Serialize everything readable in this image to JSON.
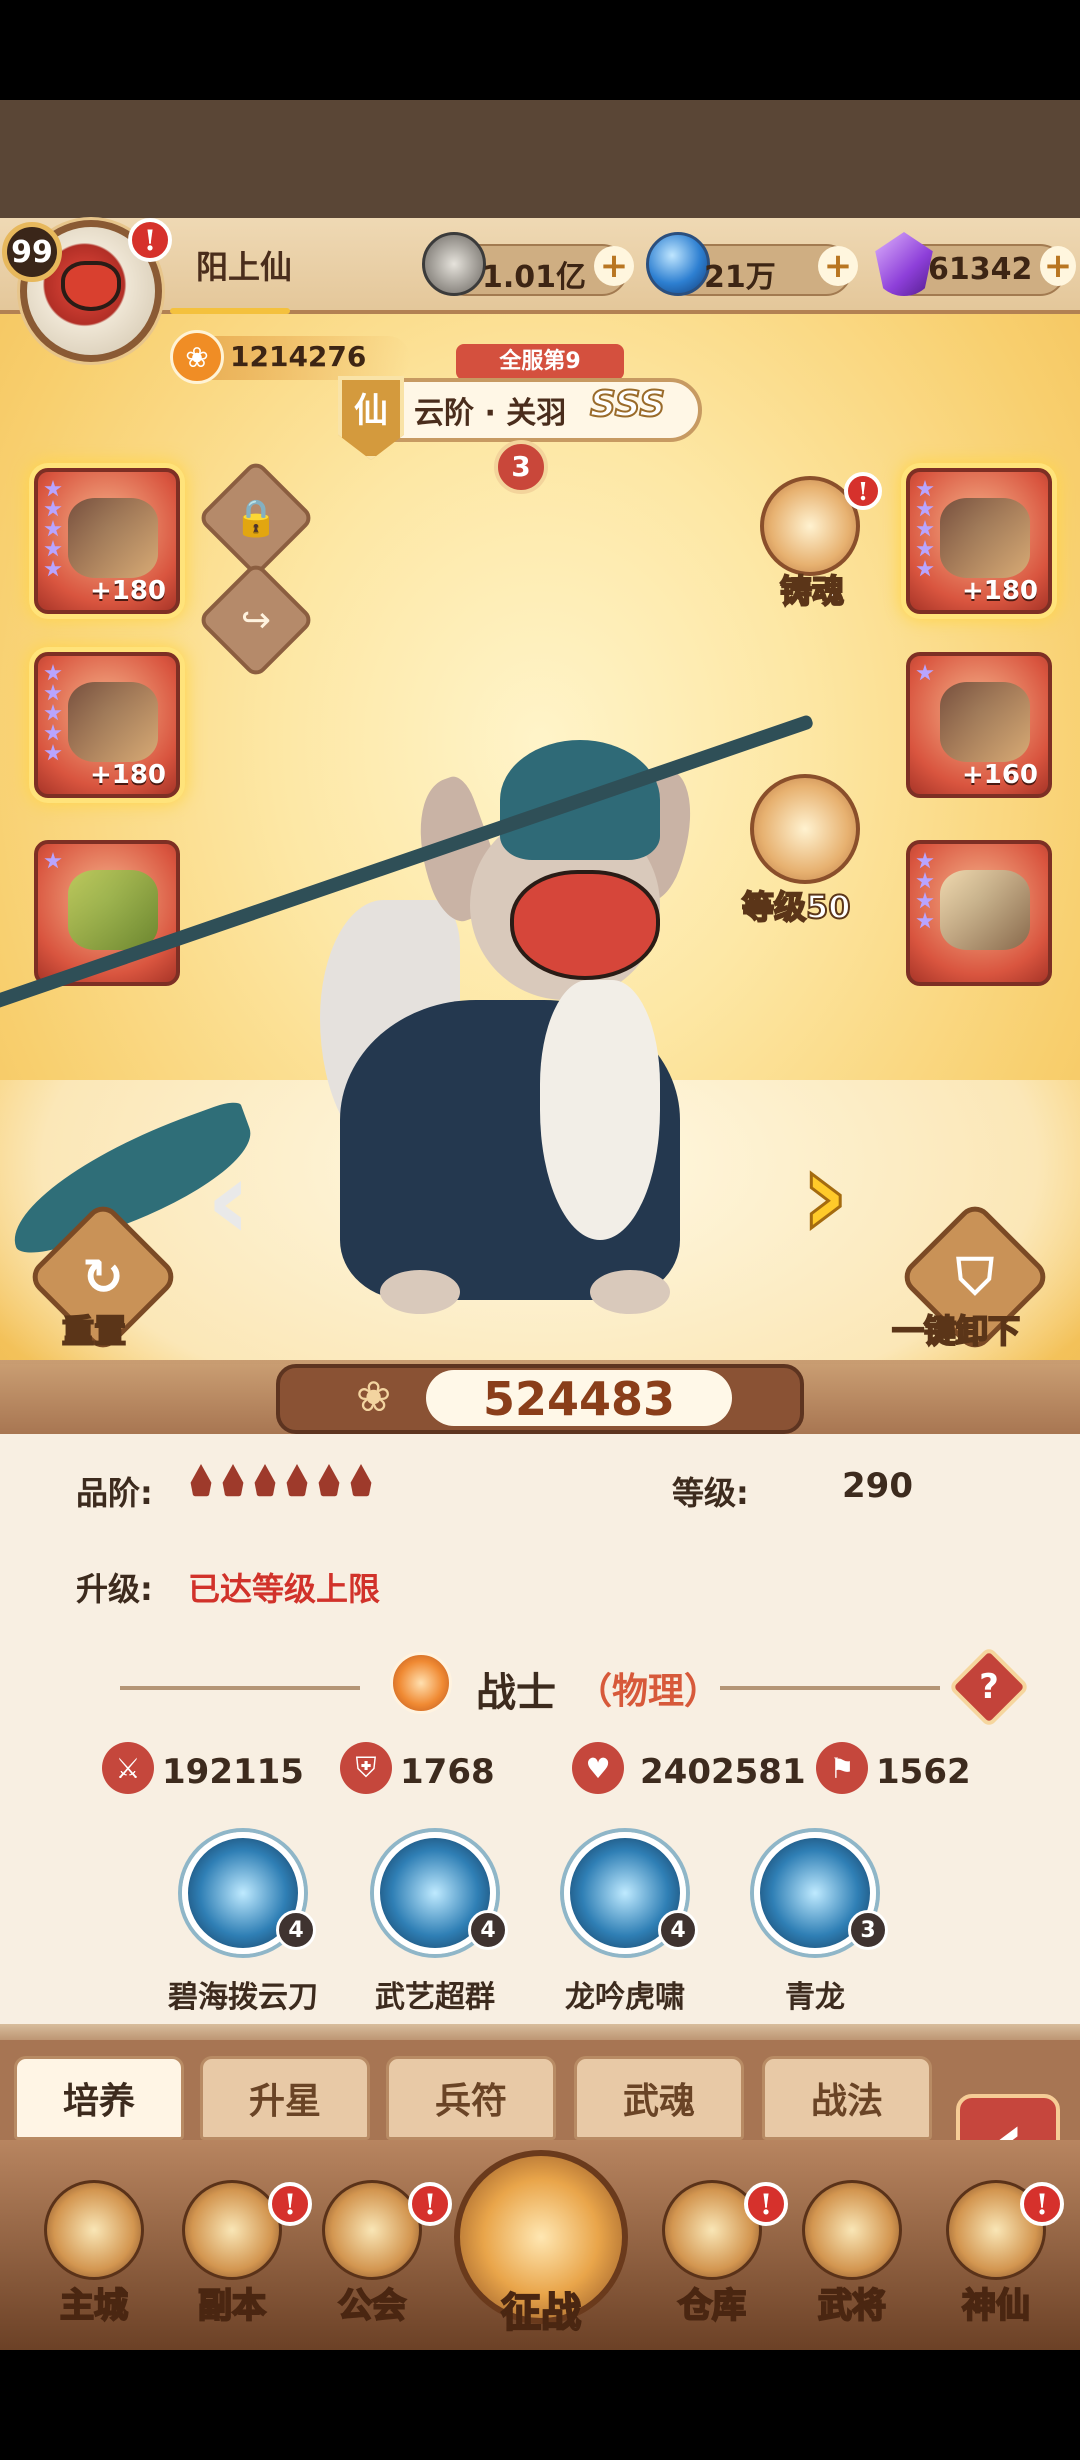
{
  "player": {
    "level": "99",
    "name": "阳上仙",
    "paw_value": "1214276"
  },
  "resources": [
    {
      "icon": "coin-icon",
      "value": "1.01亿"
    },
    {
      "icon": "blue-orb-icon",
      "value": "21万"
    },
    {
      "icon": "purple-crystal-icon",
      "value": "61342"
    }
  ],
  "hero": {
    "server_rank": "全服第9",
    "tier_badge": "仙",
    "title": "云阶 · 关羽",
    "grade": "SSS",
    "star_level": "3",
    "power": "524483"
  },
  "equipment_left": [
    {
      "name": "equip-slot-1",
      "bonus": "+180"
    },
    {
      "name": "equip-slot-2",
      "bonus": "+180"
    },
    {
      "name": "equip-slot-3",
      "bonus": ""
    }
  ],
  "equipment_right": [
    {
      "name": "equip-slot-4",
      "bonus": "+180"
    },
    {
      "name": "equip-slot-5",
      "bonus": "+160"
    },
    {
      "name": "equip-slot-6",
      "bonus": ""
    }
  ],
  "features": {
    "cast_soul": "铸魂",
    "weapon_level": "等级50",
    "reset": "重置",
    "unequip_all": "一键卸下"
  },
  "info": {
    "quality_label": "品阶:",
    "level_label": "等级:",
    "level_value": "290",
    "upgrade_label": "升级:",
    "upgrade_value": "已达等级上限",
    "class_name": "战士",
    "class_type": "（物理）",
    "help": "?"
  },
  "stats": [
    {
      "icon": "sword-icon",
      "value": "192115"
    },
    {
      "icon": "shield-icon",
      "value": "1768"
    },
    {
      "icon": "heart-icon",
      "value": "2402581"
    },
    {
      "icon": "boot-icon",
      "value": "1562"
    }
  ],
  "skills": [
    {
      "name": "碧海拨云刀",
      "level": "4"
    },
    {
      "name": "武艺超群",
      "level": "4"
    },
    {
      "name": "龙吟虎啸",
      "level": "4"
    },
    {
      "name": "青龙",
      "level": "3"
    }
  ],
  "tabs": [
    "培养",
    "升星",
    "兵符",
    "武魂",
    "战法"
  ],
  "bottom_nav": [
    {
      "label": "主城",
      "alert": false
    },
    {
      "label": "副本",
      "alert": true
    },
    {
      "label": "公会",
      "alert": true
    },
    {
      "label": "征战",
      "alert": false
    },
    {
      "label": "仓库",
      "alert": true
    },
    {
      "label": "武将",
      "alert": false
    },
    {
      "label": "神仙",
      "alert": true
    }
  ],
  "alert_mark": "!",
  "colors": {
    "accent_red": "#d1322a",
    "gold": "#f4c13d",
    "panel": "#f8efe2"
  }
}
